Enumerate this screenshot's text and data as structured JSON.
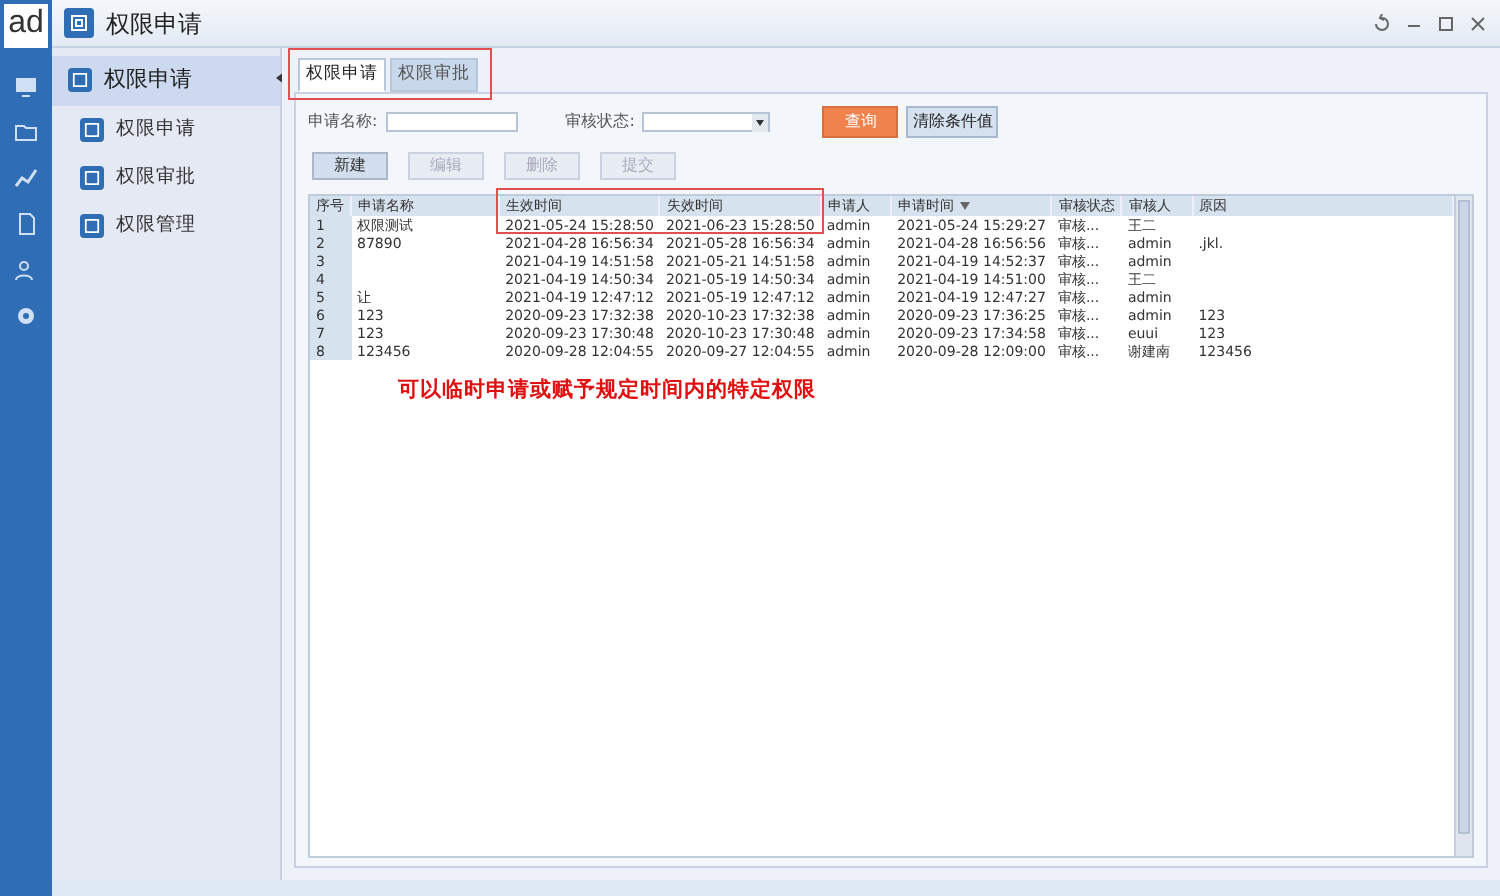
{
  "app": {
    "logo": "ad",
    "title": "权限申请"
  },
  "rail": [
    {
      "kind": "monitor"
    },
    {
      "kind": "folder"
    },
    {
      "kind": "chart"
    },
    {
      "kind": "document"
    },
    {
      "kind": "people"
    },
    {
      "kind": "gear"
    }
  ],
  "sidebar": {
    "group": {
      "label": "权限申请",
      "selected": true,
      "expanded": true
    },
    "items": [
      {
        "label": "权限申请"
      },
      {
        "label": "权限审批"
      },
      {
        "label": "权限管理"
      }
    ]
  },
  "tabs": [
    {
      "label": "权限申请",
      "selected": true
    },
    {
      "label": "权限审批",
      "selected": false
    }
  ],
  "filters": {
    "name_label": "申请名称:",
    "status_label": "审核状态:",
    "search": "查询",
    "clear": "清除条件值"
  },
  "actions": [
    {
      "label": "新建",
      "disabled": false
    },
    {
      "label": "编辑",
      "disabled": true
    },
    {
      "label": "删除",
      "disabled": true
    },
    {
      "label": "提交",
      "disabled": true
    }
  ],
  "table": {
    "columns": [
      "序号",
      "申请名称",
      "生效时间",
      "失效时间",
      "申请人",
      "申请时间",
      "审核状态",
      "审核人",
      "原因"
    ],
    "rows": [
      [
        "1",
        "权限测试",
        "2021-05-24 15:28:50",
        "2021-06-23 15:28:50",
        "admin",
        "2021-05-24 15:29:27",
        "审核...",
        "王二",
        ""
      ],
      [
        "2",
        "87890",
        "2021-04-28 16:56:34",
        "2021-05-28 16:56:34",
        "admin",
        "2021-04-28 16:56:56",
        "审核...",
        "admin",
        ".jkl."
      ],
      [
        "3",
        "",
        "2021-04-19 14:51:58",
        "2021-05-21 14:51:58",
        "admin",
        "2021-04-19 14:52:37",
        "审核...",
        "admin",
        ""
      ],
      [
        "4",
        "",
        "2021-04-19 14:50:34",
        "2021-05-19 14:50:34",
        "admin",
        "2021-04-19 14:51:00",
        "审核...",
        "王二",
        ""
      ],
      [
        "5",
        "让",
        "2021-04-19 12:47:12",
        "2021-05-19 12:47:12",
        "admin",
        "2021-04-19 12:47:27",
        "审核...",
        "admin",
        ""
      ],
      [
        "6",
        "123",
        "2020-09-23 17:32:38",
        "2020-10-23 17:32:38",
        "admin",
        "2020-09-23 17:36:25",
        "审核...",
        "admin",
        "123"
      ],
      [
        "7",
        "123",
        "2020-09-23 17:30:48",
        "2020-10-23 17:30:48",
        "admin",
        "2020-09-23 17:34:58",
        "审核...",
        "euui",
        "123"
      ],
      [
        "8",
        "123456",
        "2020-09-28 12:04:55",
        "2020-09-27 12:04:55",
        "admin",
        "2020-09-28 12:09:00",
        "审核...",
        "谢建南",
        "123456"
      ]
    ]
  },
  "annotation": "可以临时申请或赋予规定时间内的特定权限"
}
